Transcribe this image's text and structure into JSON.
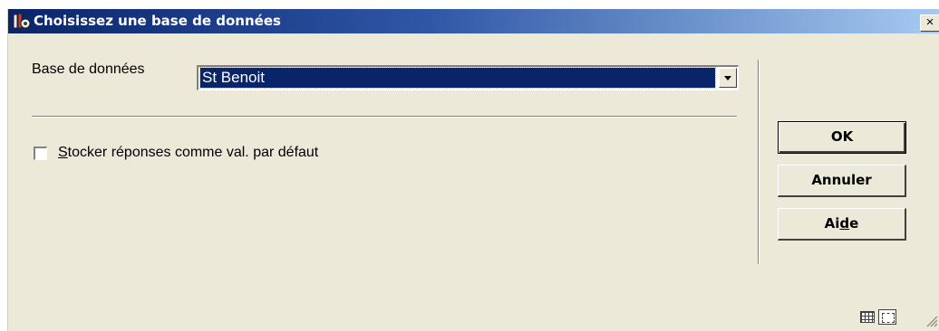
{
  "window": {
    "title": "Choisissez une base de données",
    "close_glyph": "×"
  },
  "form": {
    "database_label": "Base de données",
    "database_value": "St Benoit",
    "save_answers_checked": false,
    "save_answers_label_accesskey": "S",
    "save_answers_label_rest": "tocker réponses comme val. par défaut"
  },
  "buttons": {
    "ok": "OK",
    "cancel": "Annuler",
    "help_before": "Ai",
    "help_accesskey": "d",
    "help_after": "e"
  },
  "icons": {
    "app": "library-app-icon",
    "close": "close-icon",
    "dropdown": "chevron-down-icon",
    "status_left": "grid-icon",
    "status_right": "resize-icon",
    "grip": "size-grip-icon"
  },
  "colors": {
    "title_gradient_start": "#0a246a",
    "title_gradient_end": "#a6caf0",
    "dialog_bg": "#ece9d8",
    "selection_bg": "#0a246a"
  }
}
